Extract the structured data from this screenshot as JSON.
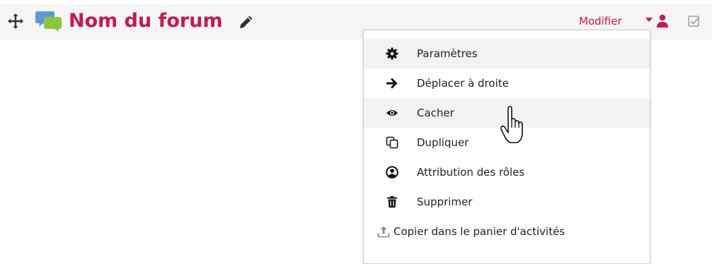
{
  "activity": {
    "title": "Nom du forum",
    "edit_menu_label": "Modifier",
    "icons": {
      "move": "move-arrows-icon",
      "forum": "forum-chat-icon",
      "edit_title": "pencil-icon",
      "caret": "caret-down-icon",
      "roles": "user-icon",
      "completion": "checkbox-icon"
    },
    "colors": {
      "accent": "#c9184a",
      "bar_bg": "#f5f5f5",
      "text": "#1d2125"
    }
  },
  "menu": {
    "items": [
      {
        "label": "Paramètres",
        "icon": "gear-icon"
      },
      {
        "label": "Déplacer à droite",
        "icon": "arrow-right-icon"
      },
      {
        "label": "Cacher",
        "icon": "eye-icon"
      },
      {
        "label": "Dupliquer",
        "icon": "copy-icon"
      },
      {
        "label": "Attribution des rôles",
        "icon": "user-circle-icon"
      },
      {
        "label": "Supprimer",
        "icon": "trash-icon"
      },
      {
        "label": "Copier dans le panier d'activités",
        "icon": "upload-tray-icon"
      }
    ]
  }
}
